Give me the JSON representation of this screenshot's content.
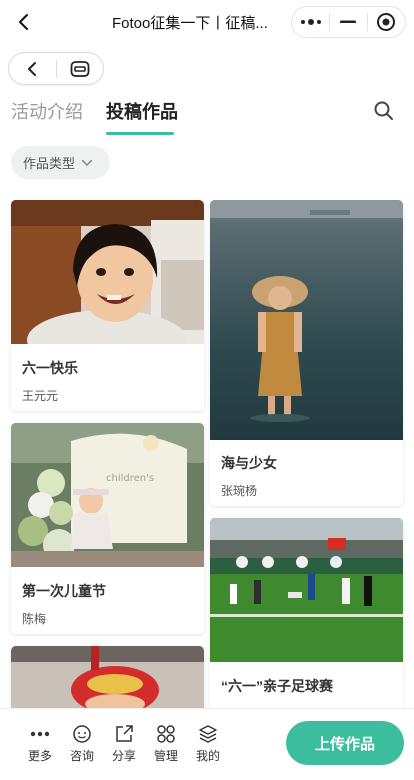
{
  "topbar": {
    "title": "Fotoo征集一下丨征稿..."
  },
  "tabs": [
    {
      "label": "活动介绍",
      "active": false
    },
    {
      "label": "投稿作品",
      "active": true
    }
  ],
  "filter": {
    "label": "作品类型"
  },
  "works": [
    {
      "title": "六一快乐",
      "author": "王元元"
    },
    {
      "title": "海与少女",
      "author": "张琬杨"
    },
    {
      "title": "第一次儿童节",
      "author": "陈梅"
    },
    {
      "title": "“六一”亲子足球赛",
      "author": ""
    },
    {
      "title": "",
      "author": ""
    }
  ],
  "bottombar": {
    "items": [
      {
        "label": "更多",
        "icon": "more-dots-icon"
      },
      {
        "label": "咨询",
        "icon": "chat-icon"
      },
      {
        "label": "分享",
        "icon": "share-icon"
      },
      {
        "label": "管理",
        "icon": "manage-grid-icon"
      },
      {
        "label": "我的",
        "icon": "layers-icon"
      }
    ],
    "upload_label": "上传作品"
  },
  "colors": {
    "accent": "#3cbd9e",
    "chip_bg": "#eff0f0"
  }
}
